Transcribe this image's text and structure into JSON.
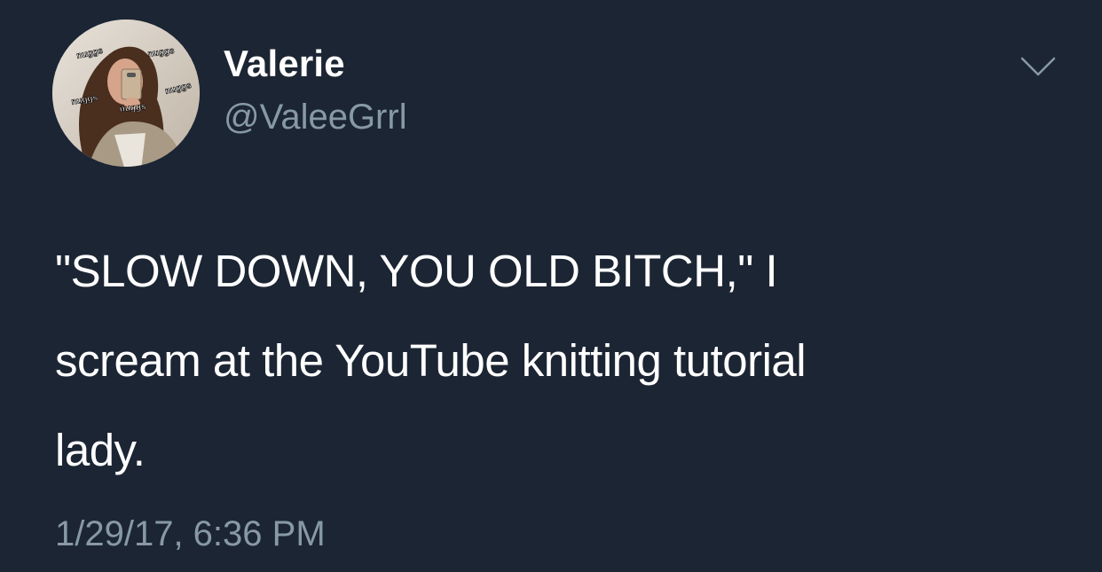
{
  "tweet": {
    "author": {
      "display_name": "Valerie",
      "handle": "@ValeeGrrl",
      "avatar_watermarks": [
        "nuggs",
        "nuggs",
        "nuggs",
        "nuggs",
        "nuggs"
      ]
    },
    "text_lines": [
      "\"SLOW DOWN, YOU OLD BITCH,\" I",
      "scream at the YouTube knitting tutorial",
      "lady."
    ],
    "timestamp": "1/29/17, 6:36 PM",
    "menu_icon": "chevron-down-icon"
  },
  "colors": {
    "background": "#1c2533",
    "primary_text": "#ffffff",
    "secondary_text": "#8899a6"
  }
}
